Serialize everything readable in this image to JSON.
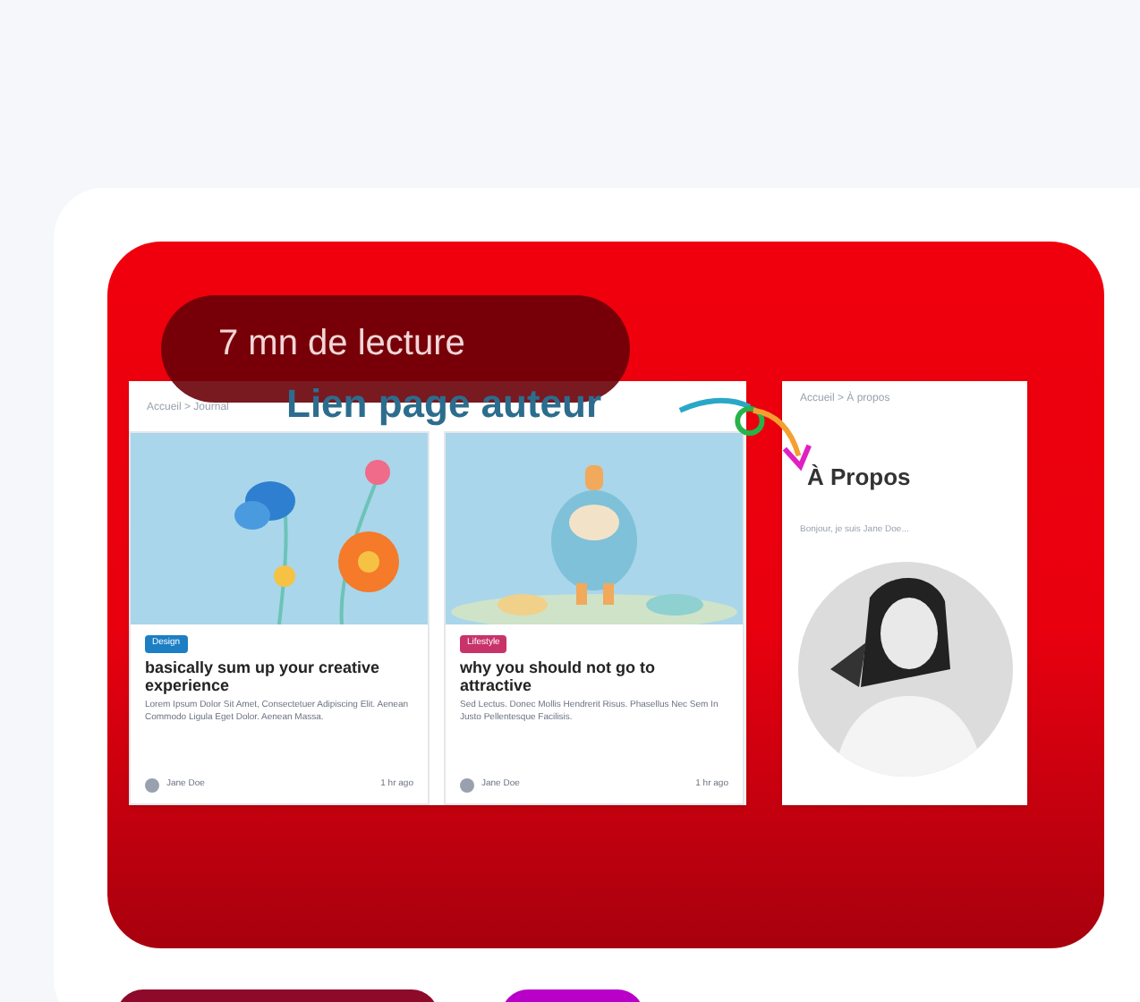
{
  "reading_time": "7 mn de lecture",
  "annotation": "Lien page auteur",
  "preview_breadcrumb": "Accueil > Journal",
  "articles": [
    {
      "tag": "Design",
      "color": "#1c7fc4",
      "title": "basically sum up your creative experience",
      "excerpt": "Lorem Ipsum Dolor Sit Amet, Consectetuer Adipiscing Elit. Aenean Commodo Ligula Eget Dolor. Aenean Massa.",
      "author": "Jane Doe",
      "time": "1 hr ago"
    },
    {
      "tag": "Lifestyle",
      "color": "#c8336a",
      "title": "why you should not go to attractive",
      "excerpt": "Sed Lectus. Donec Mollis Hendrerit Risus. Phasellus Nec Sem In Justo Pellentesque Facilisis.",
      "author": "Jane Doe",
      "time": "1 hr ago"
    }
  ],
  "about": {
    "breadcrumb": "Accueil > À propos",
    "title": "À Propos",
    "intro": "Bonjour, je suis Jane Doe..."
  },
  "bottom_tags": [
    {
      "color": "#8e0a2a"
    },
    {
      "color": "#b800c8"
    }
  ]
}
